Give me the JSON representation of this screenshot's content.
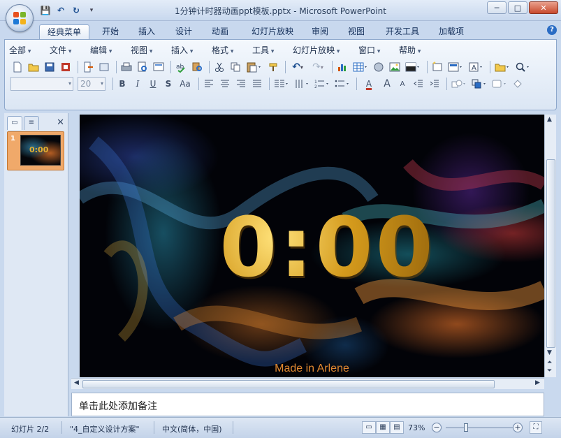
{
  "window": {
    "title": "1分钟计时器动画ppt模板.pptx - Microsoft PowerPoint",
    "controls": {
      "minimize": "─",
      "maximize": "□",
      "close": "✕"
    }
  },
  "quick_access": {
    "save": "💾",
    "undo": "↶",
    "redo": "↻",
    "customize": "▾"
  },
  "ribbon_tabs": [
    "经典菜单",
    "开始",
    "插入",
    "设计",
    "动画",
    "幻灯片放映",
    "审阅",
    "视图",
    "开发工具",
    "加载项"
  ],
  "active_tab": "经典菜单",
  "help": "?",
  "menus": [
    "全部",
    "文件",
    "编辑",
    "视图",
    "插入",
    "格式",
    "工具",
    "幻灯片放映",
    "窗口",
    "帮助"
  ],
  "font": {
    "name": "",
    "size": "20"
  },
  "format_buttons": {
    "bold": "B",
    "italic": "I",
    "underline": "U",
    "shadow": "S",
    "case": "Aa",
    "font_color": "A",
    "grow": "A",
    "shrink": "A"
  },
  "left_pane": {
    "close": "✕",
    "tab_slides": "▭",
    "tab_outline": "≡",
    "slide_number": "1",
    "thumb_text": "0:00"
  },
  "slide": {
    "clock": "0:00",
    "credit": "Made in Arlene"
  },
  "notes": {
    "placeholder": "单击此处添加备注"
  },
  "status": {
    "slide": "幻灯片 2/2",
    "theme": "\"4_自定义设计方案\"",
    "language": "中文(简体，中国)",
    "zoom": "73%",
    "zoom_minus": "−",
    "zoom_plus": "+"
  }
}
